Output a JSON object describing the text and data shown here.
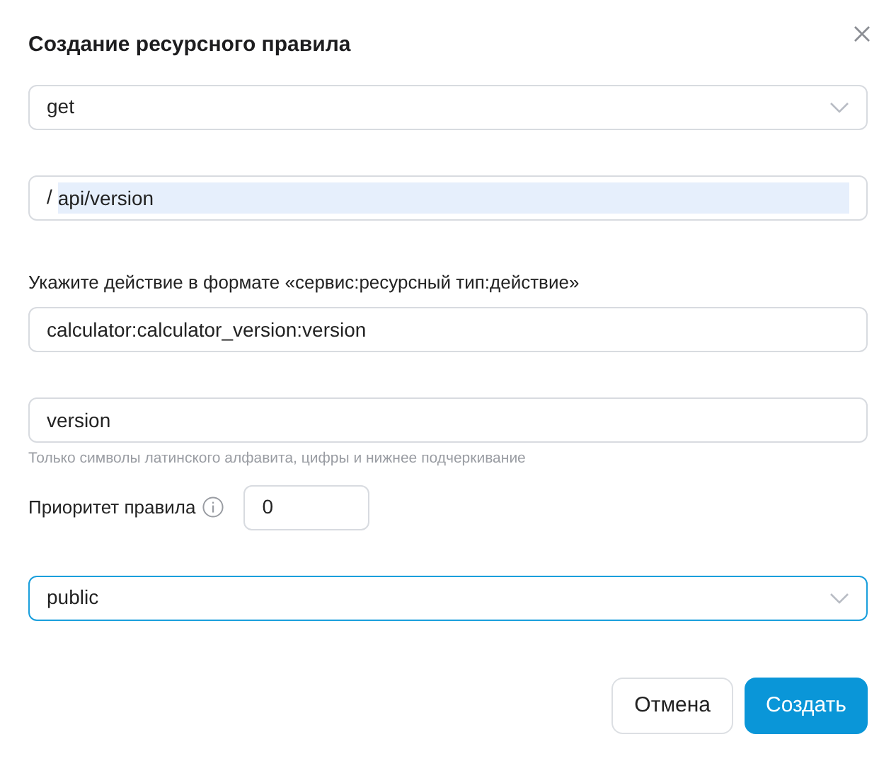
{
  "dialog": {
    "title": "Создание ресурсного правила"
  },
  "method_select": {
    "value": "get",
    "focused": false
  },
  "path_field": {
    "prefix": "/",
    "value": "api/version",
    "text_selected": true
  },
  "action_label": "Укажите действие в формате «сервис:ресурсный тип:действие»",
  "action_field": {
    "value": "calculator:calculator_version:version"
  },
  "name_field": {
    "value": "version",
    "hint": "Только символы латинского алфавита, цифры и нижнее подчеркивание"
  },
  "priority": {
    "label": "Приоритет правила",
    "value": "0"
  },
  "access_select": {
    "value": "public",
    "focused": true
  },
  "buttons": [
    {
      "label": "Отмена",
      "kind": "secondary"
    },
    {
      "label": "Создать",
      "kind": "primary"
    }
  ]
}
